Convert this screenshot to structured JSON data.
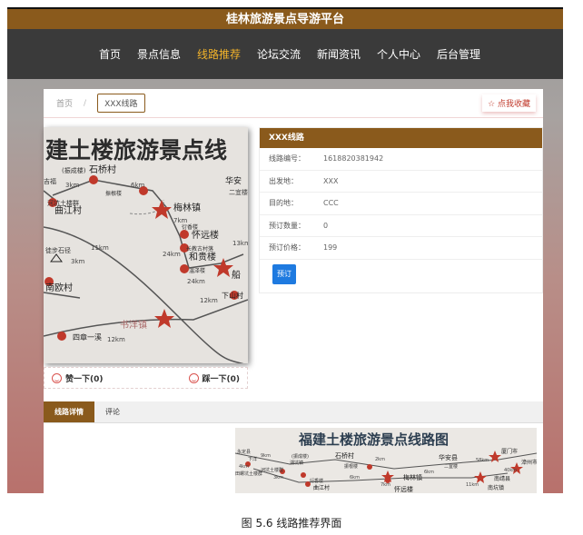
{
  "header": {
    "title": "桂林旅游景点导游平台"
  },
  "nav": {
    "items": [
      {
        "label": "首页"
      },
      {
        "label": "景点信息"
      },
      {
        "label": "线路推荐"
      },
      {
        "label": "论坛交流"
      },
      {
        "label": "新闻资讯"
      },
      {
        "label": "个人中心"
      },
      {
        "label": "后台管理"
      }
    ],
    "active_index": 2
  },
  "breadcrumb": {
    "home": "首页",
    "separator": "/",
    "current": "XXX线路"
  },
  "favorite_label": "☆ 点我收藏",
  "route_map": {
    "banner": "建土楼旅游景点线",
    "places": [
      "石桥村",
      "曲江村",
      "梅林镇",
      "怀远楼",
      "和贵楼",
      "南欧村",
      "书洋镇",
      "四章一溪",
      "华安",
      "二宜楼",
      "船",
      "下山村"
    ],
    "small_labels": [
      "(振成楼)",
      "河坑土楼群",
      "徒步石径",
      "振根楼",
      "衍香楼",
      "长教古村落",
      "温泽楼",
      "吉福"
    ],
    "distances": [
      "3km",
      "6km",
      "11km",
      "3km",
      "7km",
      "24km",
      "12km",
      "13km",
      "12km",
      "24km"
    ]
  },
  "likes": {
    "like_label": "赞一下(0)",
    "dislike_label": "踩一下(0)"
  },
  "route_info": {
    "title": "XXX线路",
    "rows": [
      {
        "key": "线路编号：",
        "value": "1618820381942"
      },
      {
        "key": "出发地：",
        "value": "XXX"
      },
      {
        "key": "目的地：",
        "value": "CCC"
      },
      {
        "key": "预订数量：",
        "value": "0"
      },
      {
        "key": "预订价格：",
        "value": "199"
      }
    ],
    "book_label": "预订"
  },
  "tabs": [
    {
      "label": "线路详情"
    },
    {
      "label": "评论"
    }
  ],
  "detail_map": {
    "banner": "福建土楼旅游景点线路图",
    "places": [
      "石桥村",
      "华安县",
      "二宜楼",
      "梅林镇",
      "厦门市",
      "漳州市",
      "南靖县",
      "怀远楼",
      "南坑镇"
    ],
    "small_labels": [
      "永定县",
      "下洋",
      "(振成楼)",
      "湖坑镇",
      "衍香楼",
      "河坑土楼群",
      "振根楼",
      "曲江村",
      "田螺坑土楼群"
    ],
    "distances": [
      "4km",
      "9km",
      "3km",
      "6km",
      "2km",
      "58km",
      "40km",
      "11km",
      "6km",
      "7km"
    ]
  },
  "caption": "图 5.6  线路推荐界面",
  "colors": {
    "brand_brown": "#8a5a1c",
    "nav_dark": "#3a3a3a",
    "nav_active": "#f2b32a",
    "book_blue": "#1e7ae0",
    "map_red": "#c0392b"
  }
}
